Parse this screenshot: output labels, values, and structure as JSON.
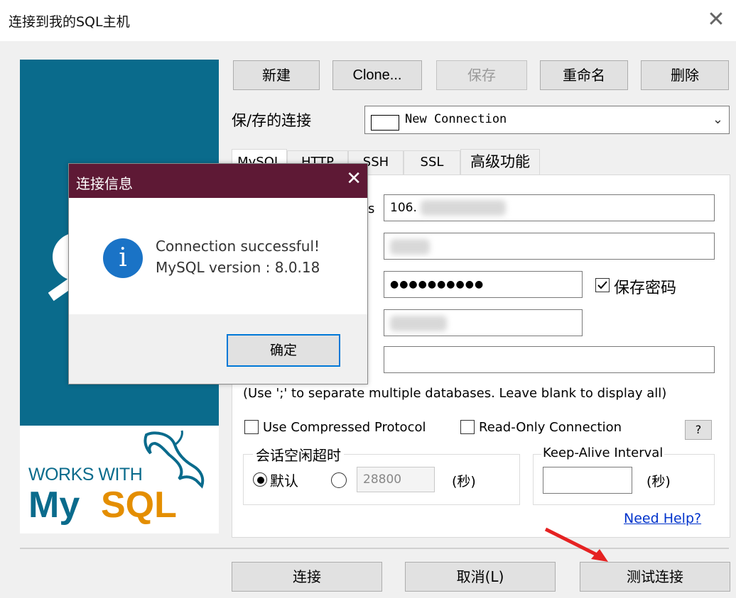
{
  "window": {
    "title": "连接到我的SQL主机",
    "close": "✕"
  },
  "logo": {
    "works_with": "WORKS WITH",
    "mysql_my": "My",
    "mysql_sql": "SQL"
  },
  "toolbar": {
    "new": "新建",
    "clone": "Clone...",
    "save": "保存",
    "rename": "重命名",
    "delete": "删除"
  },
  "saved_connections": {
    "label": "保/存的连接",
    "value": "New Connection"
  },
  "tabs": [
    "MySQL",
    "HTTP",
    "SSH",
    "SSL",
    "高级功能"
  ],
  "fields": {
    "host_value": "106.",
    "host_label_tail": "s",
    "password_mask": "●●●●●●●●●●",
    "save_password": "保存密码",
    "databases_hint": "(Use ';' to separate multiple databases. Leave blank to display all)"
  },
  "options": {
    "compressed": "Use Compressed Protocol",
    "readonly": "Read-Only Connection",
    "help_q": "?"
  },
  "session": {
    "title": "会话空闲超时",
    "default": "默认",
    "timeout": "28800",
    "unit": "(秒)"
  },
  "keepalive": {
    "title": "Keep-Alive Interval",
    "unit": "(秒)"
  },
  "need_help": "Need Help?",
  "footer": {
    "connect": "连接",
    "cancel": "取消(L)",
    "test": "测试连接"
  },
  "modal": {
    "title": "连接信息",
    "close": "✕",
    "icon": "i",
    "line1": "Connection successful!",
    "line2": "MySQL version : 8.0.18",
    "ok": "确定"
  },
  "colors": {
    "logo_blue": "#0a6b8c",
    "logo_orange": "#e48e00",
    "modal_title": "#5e1935",
    "info_icon": "#1a73c6",
    "link": "#0033cc"
  }
}
